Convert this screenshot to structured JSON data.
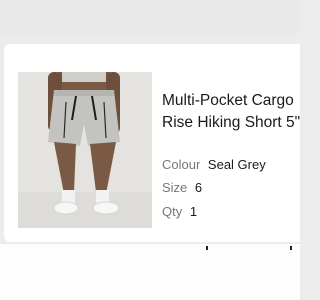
{
  "product": {
    "title_line1": "Multi-Pocket Cargo",
    "title_line2": "Rise Hiking Short 5\"",
    "image_alt": "product-photo"
  },
  "specs": {
    "colour_label": "Colour",
    "colour_value": "Seal Grey",
    "size_label": "Size",
    "size_value": "6",
    "qty_label": "Qty",
    "qty_value": "1"
  },
  "colors": {
    "background": "#ececec",
    "card": "#ffffff",
    "text_primary": "#1a1a1a",
    "text_muted": "#777777",
    "product_grey": "#bfbfbb"
  }
}
